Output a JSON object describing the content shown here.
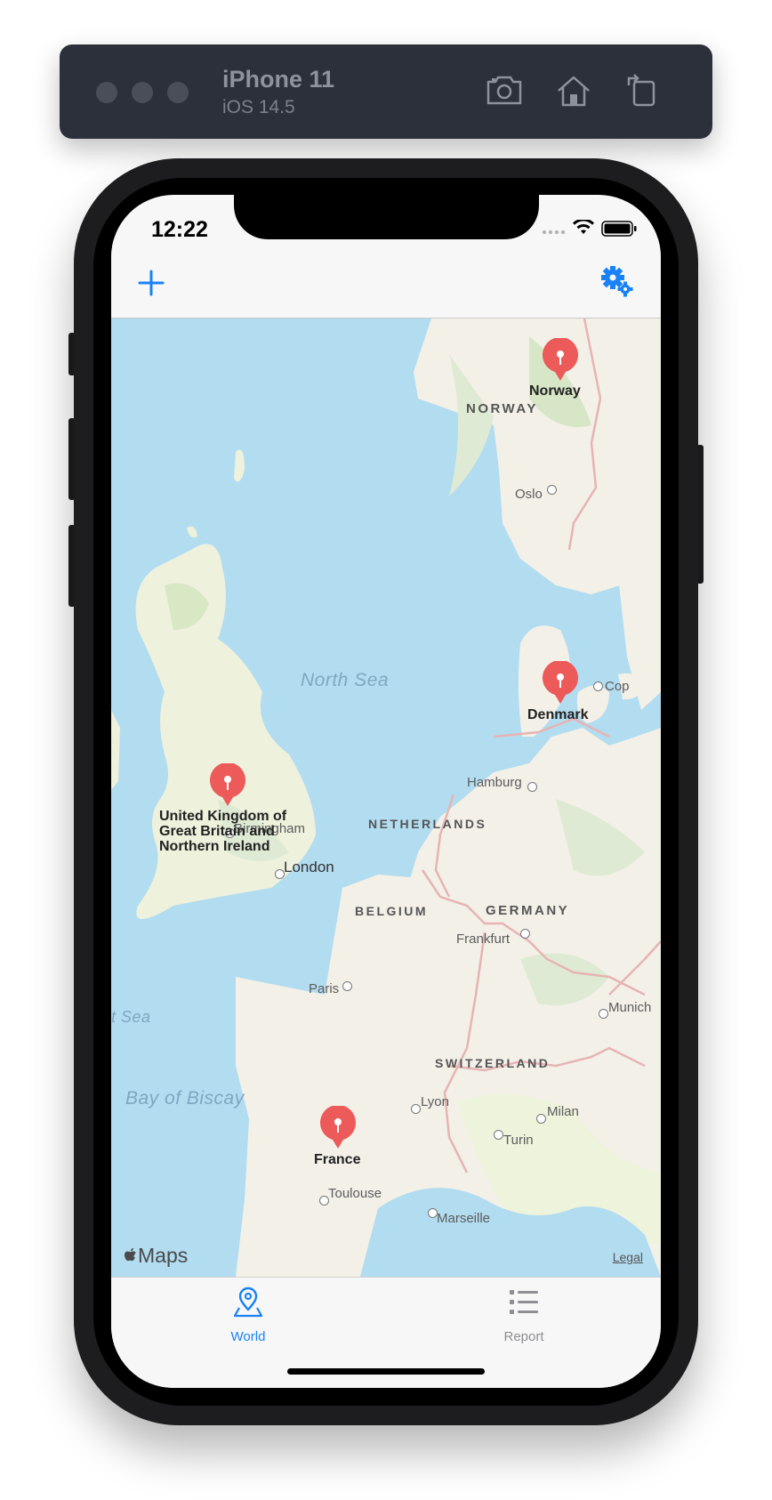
{
  "simulator": {
    "device": "iPhone 11",
    "os": "iOS 14.5",
    "icons": [
      "screenshot-icon",
      "home-icon",
      "rotate-icon"
    ]
  },
  "status_bar": {
    "time": "12:22"
  },
  "nav": {
    "add_icon": "plus-icon",
    "settings_icon": "gear-icon",
    "accent": "#1a82f7"
  },
  "map": {
    "seas": [
      "North Sea",
      "Bay of Biscay",
      "t Sea"
    ],
    "countries": [
      "NORWAY",
      "NETHERLANDS",
      "BELGIUM",
      "GERMANY",
      "SWITZERLAND"
    ],
    "cities": [
      "Oslo",
      "Cop",
      "Hamburg",
      "Birmingham",
      "London",
      "Frankfurt",
      "Paris",
      "Munich",
      "Lyon",
      "Milan",
      "Turin",
      "Toulouse",
      "Marseille"
    ],
    "pins": [
      {
        "label": "Norway"
      },
      {
        "label": "Denmark"
      },
      {
        "label": "United Kingdom of Great Britain and Northern Ireland",
        "lines": [
          "United Kingdom of",
          "Great Britain and",
          "Northern Ireland"
        ]
      },
      {
        "label": "France"
      }
    ],
    "pin_color": "#ec5a5a",
    "logo": "Maps",
    "legal": "Legal"
  },
  "tabs": [
    {
      "label": "World",
      "icon": "map-pin-icon",
      "selected": true,
      "color": "#1a82f7"
    },
    {
      "label": "Report",
      "icon": "list-icon",
      "selected": false,
      "color": "#8e8e93"
    }
  ]
}
